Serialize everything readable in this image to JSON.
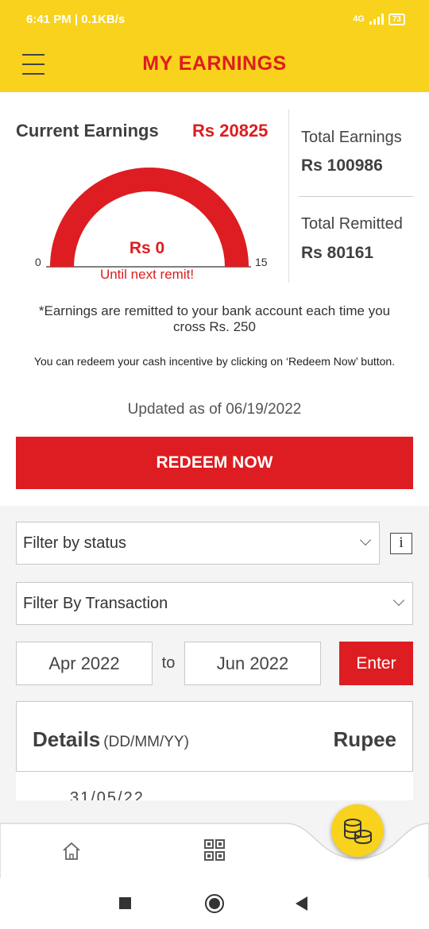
{
  "status_bar": {
    "time": "6:41 PM | 0.1KB/s",
    "network": "4G",
    "battery": "73"
  },
  "header": {
    "title": "MY EARNINGS"
  },
  "earnings": {
    "current_label": "Current Earnings",
    "current_value": "Rs 20825",
    "total_label": "Total Earnings",
    "total_value": "Rs 100986",
    "remitted_label": "Total Remitted",
    "remitted_value": "Rs 80161"
  },
  "gauge": {
    "min": "0",
    "max": "15",
    "value": "Rs 0",
    "sub": "Until next remit!",
    "fill_fraction": 1.0,
    "color": "#dd1d21"
  },
  "notes": {
    "remit_note": "*Earnings are remitted to your bank account each time you cross Rs. 250",
    "redeem_note": "You can redeem your cash incentive by clicking on ‘Redeem Now’ button.",
    "updated": "Updated as of 06/19/2022"
  },
  "actions": {
    "redeem_label": "REDEEM NOW"
  },
  "filters": {
    "status_value": "Filter by status",
    "transaction_value": "Filter By Transaction",
    "info_label": "i",
    "from_date": "Apr 2022",
    "to_label": "to",
    "to_date": "Jun 2022",
    "enter_label": "Enter"
  },
  "details": {
    "title": "Details",
    "format": "(DD/MM/YY)",
    "amount_header": "Rupee",
    "first_row_date": "31/05/22"
  },
  "colors": {
    "brand_yellow": "#f8d21c",
    "brand_red": "#dd1d21"
  },
  "icons": {
    "menu": "hamburger-icon",
    "home": "home-icon",
    "qr": "qr-code-icon",
    "coins": "coins-icon"
  }
}
